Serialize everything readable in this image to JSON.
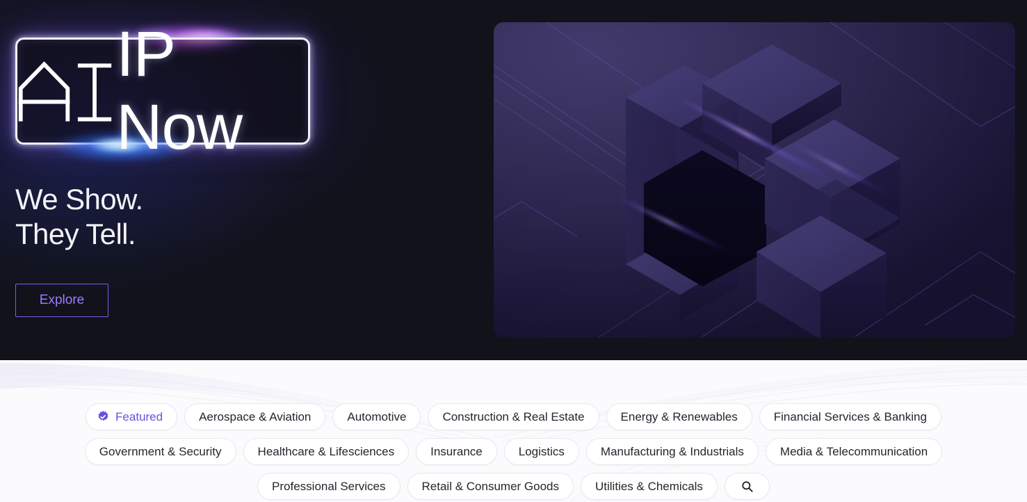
{
  "hero": {
    "logo": {
      "text_a": "A",
      "text_rest": "IP Now",
      "full": "AIP Now",
      "icon": "neon-logo-box"
    },
    "tagline_line1": "We Show.",
    "tagline_line2": "They Tell.",
    "cta_label": "Explore",
    "art_alt": "isometric-3d-blocks"
  },
  "colors": {
    "dark_bg": "#11121a",
    "accent_purple": "#7d5cf0",
    "accent_text": "#9c7bff",
    "featured_purple": "#6b4fe0",
    "light_bg": "#fbfbfd",
    "pill_border": "#e7e7ee",
    "pill_text": "#25262e",
    "neon_top_glow": "#ff6ee6",
    "neon_bottom_glow": "#2a7bff"
  },
  "filters": {
    "rows": [
      [
        {
          "label": "Featured",
          "icon": "verified-badge-icon",
          "selected": true
        },
        {
          "label": "Aerospace & Aviation",
          "selected": false
        },
        {
          "label": "Automotive",
          "selected": false
        },
        {
          "label": "Construction & Real Estate",
          "selected": false
        },
        {
          "label": "Energy & Renewables",
          "selected": false
        },
        {
          "label": "Financial Services & Banking",
          "selected": false
        }
      ],
      [
        {
          "label": "Government & Security",
          "selected": false
        },
        {
          "label": "Healthcare & Lifesciences",
          "selected": false
        },
        {
          "label": "Insurance",
          "selected": false
        },
        {
          "label": "Logistics",
          "selected": false
        },
        {
          "label": "Manufacturing & Industrials",
          "selected": false
        },
        {
          "label": "Media & Telecommunication",
          "selected": false
        }
      ],
      [
        {
          "label": "Professional Services",
          "selected": false
        },
        {
          "label": "Retail & Consumer Goods",
          "selected": false
        },
        {
          "label": "Utilities & Chemicals",
          "selected": false
        }
      ]
    ],
    "search_button": {
      "label": "",
      "icon": "search-icon"
    }
  }
}
